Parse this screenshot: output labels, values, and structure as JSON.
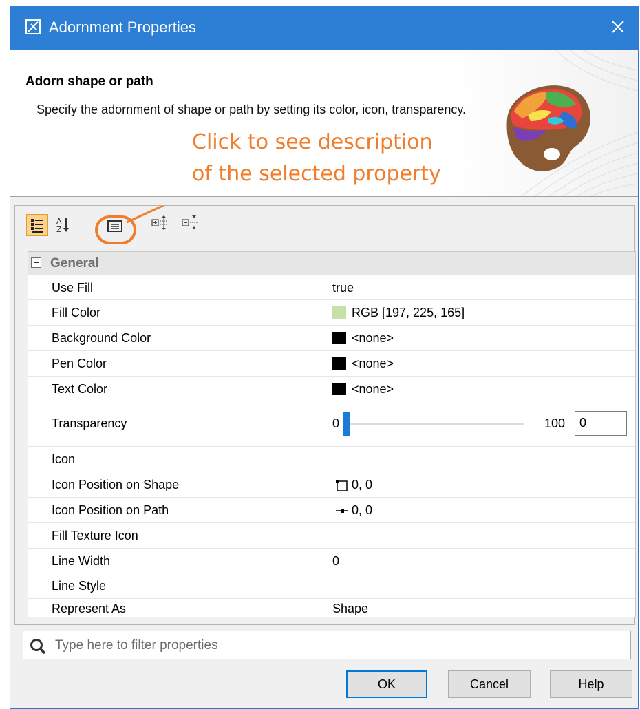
{
  "window": {
    "title": "Adornment Properties"
  },
  "header": {
    "title": "Adorn shape or path",
    "description": "Specify the adornment of shape or path by setting its color, icon, transparency."
  },
  "annotation": {
    "line1": "Click to see description",
    "line2": "of the selected property",
    "color": "#f07d2c"
  },
  "toolbar": {
    "buttons": [
      {
        "icon": "categorized-view-icon",
        "active": true
      },
      {
        "icon": "sort-alphabetical-icon",
        "active": false
      },
      {
        "icon": "show-description-icon",
        "active": false
      },
      {
        "icon": "expand-all-icon",
        "active": false
      },
      {
        "icon": "collapse-all-icon",
        "active": false
      }
    ]
  },
  "group": {
    "label": "General",
    "expanded": true
  },
  "properties": [
    {
      "name": "Use Fill",
      "value": "true"
    },
    {
      "name": "Fill Color",
      "value": "RGB [197, 225, 165]",
      "swatch": "#c5e1a5"
    },
    {
      "name": "Background Color",
      "value": "<none>",
      "swatch": "#000000"
    },
    {
      "name": "Pen Color",
      "value": "<none>",
      "swatch": "#000000"
    },
    {
      "name": "Text Color",
      "value": "<none>",
      "swatch": "#000000"
    },
    {
      "name": "Transparency",
      "slider_min": "0",
      "slider_max": "100",
      "value": "0",
      "level": 0
    },
    {
      "name": "Icon",
      "value": ""
    },
    {
      "name": "Icon Position on Shape",
      "value": "0, 0",
      "icon": "shape-corner-icon"
    },
    {
      "name": "Icon Position on Path",
      "value": "0, 0",
      "icon": "path-point-icon"
    },
    {
      "name": "Fill Texture Icon",
      "value": ""
    },
    {
      "name": "Line Width",
      "value": "0"
    },
    {
      "name": "Line Style",
      "value": ""
    },
    {
      "name": "Represent As",
      "value": "Shape"
    }
  ],
  "filter": {
    "placeholder": "Type here to filter properties"
  },
  "buttons": {
    "ok": "OK",
    "cancel": "Cancel",
    "help": "Help"
  },
  "colors": {
    "titlebar": "#2d7fd6",
    "accent": "#0078d7",
    "slider": "#1a7cd8"
  }
}
